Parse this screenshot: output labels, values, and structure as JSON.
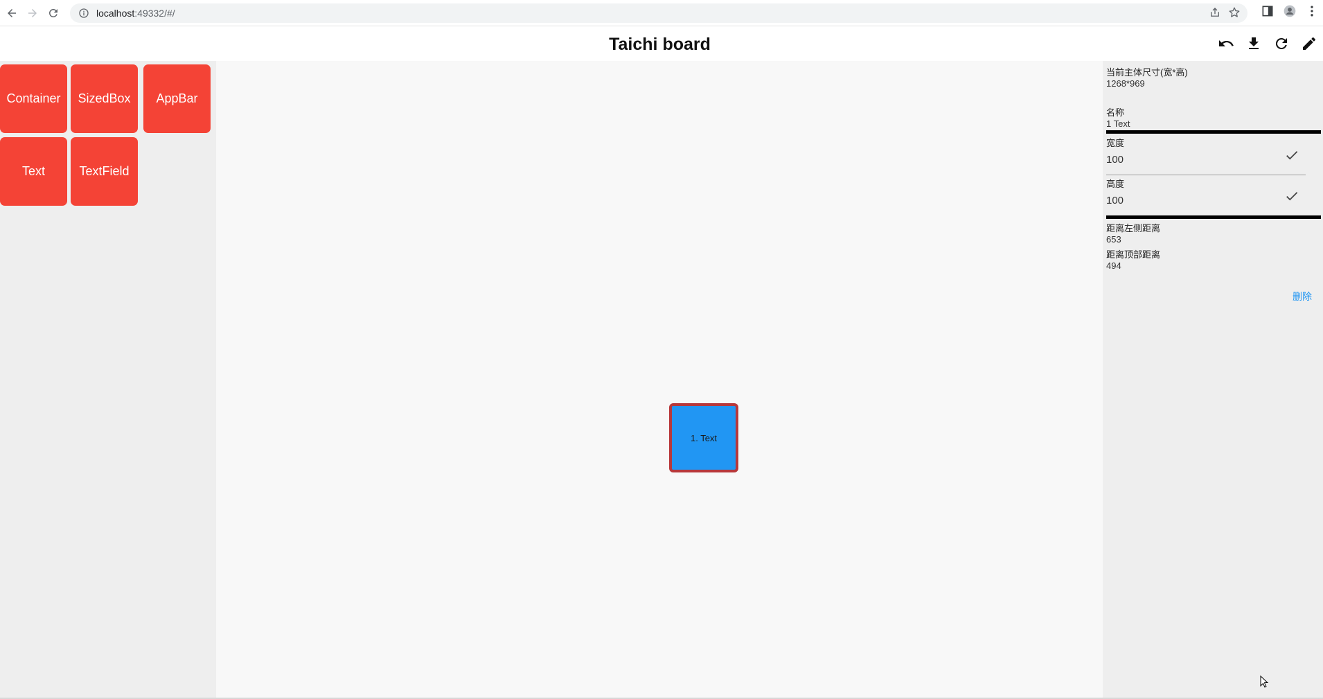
{
  "browser": {
    "url_host": "localhost",
    "url_rest": ":49332/#/",
    "icons": [
      "back-icon",
      "forward-icon",
      "reload-icon",
      "info-icon",
      "share-icon",
      "star-icon",
      "sidepanel-icon",
      "profile-icon",
      "menu-icon"
    ]
  },
  "appbar": {
    "title": "Taichi board",
    "actions": [
      "undo-icon",
      "download-icon",
      "refresh-icon",
      "edit-icon"
    ]
  },
  "palette": {
    "items": [
      {
        "label": "Container"
      },
      {
        "label": "SizedBox"
      },
      {
        "label": "AppBar"
      },
      {
        "label": "Text"
      },
      {
        "label": "TextField"
      }
    ],
    "color": "#f44336"
  },
  "canvas": {
    "node": {
      "label": "1. Text",
      "fill": "#2196f3",
      "border": "#b7383b"
    }
  },
  "props": {
    "size_label": "当前主体尺寸(宽*高)",
    "size_value": "1268*969",
    "name_label": "名称",
    "name_value": "1 Text",
    "width_label": "宽度",
    "width_value": "100",
    "height_label": "高度",
    "height_value": "100",
    "left_label": "距离左侧距离",
    "left_value": "653",
    "top_label": "距离顶部距离",
    "top_value": "494",
    "delete_label": "删除"
  }
}
